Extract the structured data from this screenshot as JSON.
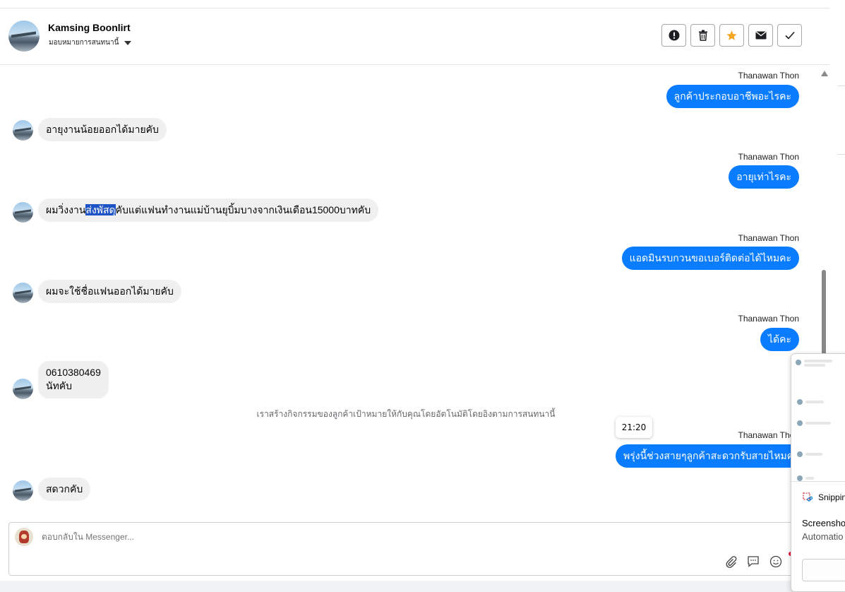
{
  "header": {
    "contact_name": "Kamsing Boonlirt",
    "assign_label": "มอบหมายการสนทนานี้",
    "actions": [
      "spam-icon",
      "trash-icon",
      "star-icon",
      "mail-icon",
      "check-icon"
    ]
  },
  "colors": {
    "outgoing": "#0a7cff",
    "incoming": "#f0f0f0",
    "star": "#f5a623",
    "highlight": "#1e53c7"
  },
  "messages": {
    "m1_sender": "Thanawan Thon",
    "m1_text": "ลูกค้าประกอบอาชีพอะไรคะ",
    "m2_text": "อายุงานน้อยออกได้มายคับ",
    "m3_sender": "Thanawan Thon",
    "m3_text": "อายุเท่าไรคะ",
    "m4_pre": "ผมวิ่งงาน",
    "m4_hl": "ส่งพัสดุ",
    "m4_post": "คับแต่แฟนทำงานแม่บ้านยุบิ้มบางจากเงินเดือน15000บาทคับ",
    "m5_sender": "Thanawan Thon",
    "m5_text": "แอดมินรบกวนขอเบอร์ติดต่อได้ไหมคะ",
    "m6_text": "ผมจะใช้ชื่อแฟนออกได้มายคับ",
    "m7_sender": "Thanawan Thon",
    "m7_text": "ได้คะ",
    "m8_line1": "0610380469",
    "m8_line2": "นัทคับ",
    "system": "เราสร้างกิจกรรมของลูกค้าเป้าหมายให้กับคุณโดยอัตโนมัติโดยอิงตามการสนทนานี้",
    "tooltip_time": "21:20",
    "m9_sender": "Thanawan Thon",
    "m9_text": "พรุ่งนี้ช่วงสายๆลูกค้าสะดวกรับสายไหมคะ",
    "m10_text": "สดวกคับ"
  },
  "composer": {
    "placeholder": "ตอบกลับใน Messenger...",
    "icons": [
      "attachment-icon",
      "saved-reply-icon",
      "emoji-icon",
      "baht-icon"
    ]
  },
  "popup": {
    "app_title": "Snippin",
    "line1": "Screensho",
    "line2": "Automatio"
  }
}
